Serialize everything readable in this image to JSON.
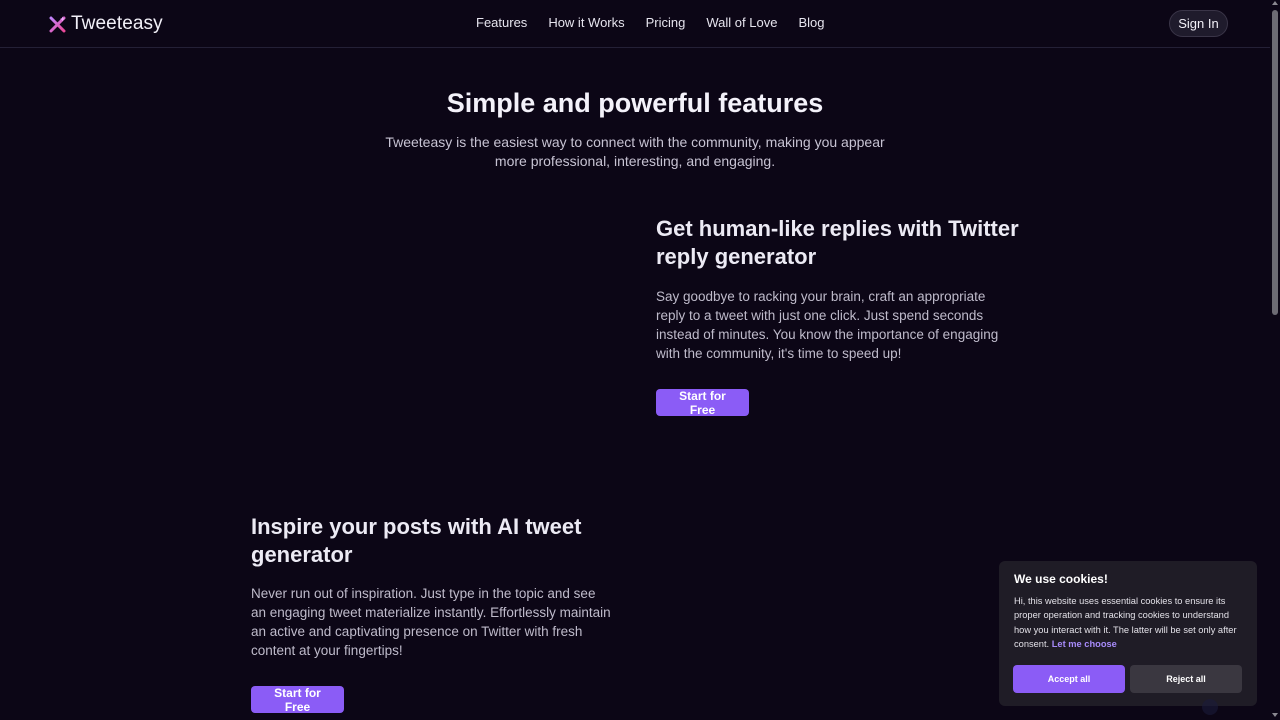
{
  "header": {
    "brand": "Tweeteasy",
    "nav": [
      "Features",
      "How it Works",
      "Pricing",
      "Wall of Love",
      "Blog"
    ],
    "signin_label": "Sign In"
  },
  "hero": {
    "title": "Simple and powerful features",
    "subtitle": "Tweeteasy is the easiest way to connect with the community, making you appear more professional, interesting, and engaging."
  },
  "features": [
    {
      "title": "Get human-like replies with Twitter reply generator",
      "description": "Say goodbye to racking your brain, craft an appropriate reply to a tweet with just one click. Just spend seconds instead of minutes. You know the importance of engaging with the community, it's time to speed up!",
      "cta": "Start for Free"
    },
    {
      "title": "Inspire your posts with AI tweet generator",
      "description": "Never run out of inspiration. Just type in the topic and see an engaging tweet materialize instantly. Effortlessly maintain an active and captivating presence on Twitter with fresh content at your fingertips!",
      "cta": "Start for Free"
    }
  ],
  "cookie": {
    "title": "We use cookies!",
    "text": "Hi, this website uses essential cookies to ensure its proper operation and tracking cookies to understand how you interact with it. The latter will be set only after consent.",
    "link": "Let me choose",
    "accept": "Accept all",
    "reject": "Reject all"
  },
  "colors": {
    "background": "#0c0616",
    "accent": "#8b5cf6",
    "link": "#a78bfa"
  }
}
